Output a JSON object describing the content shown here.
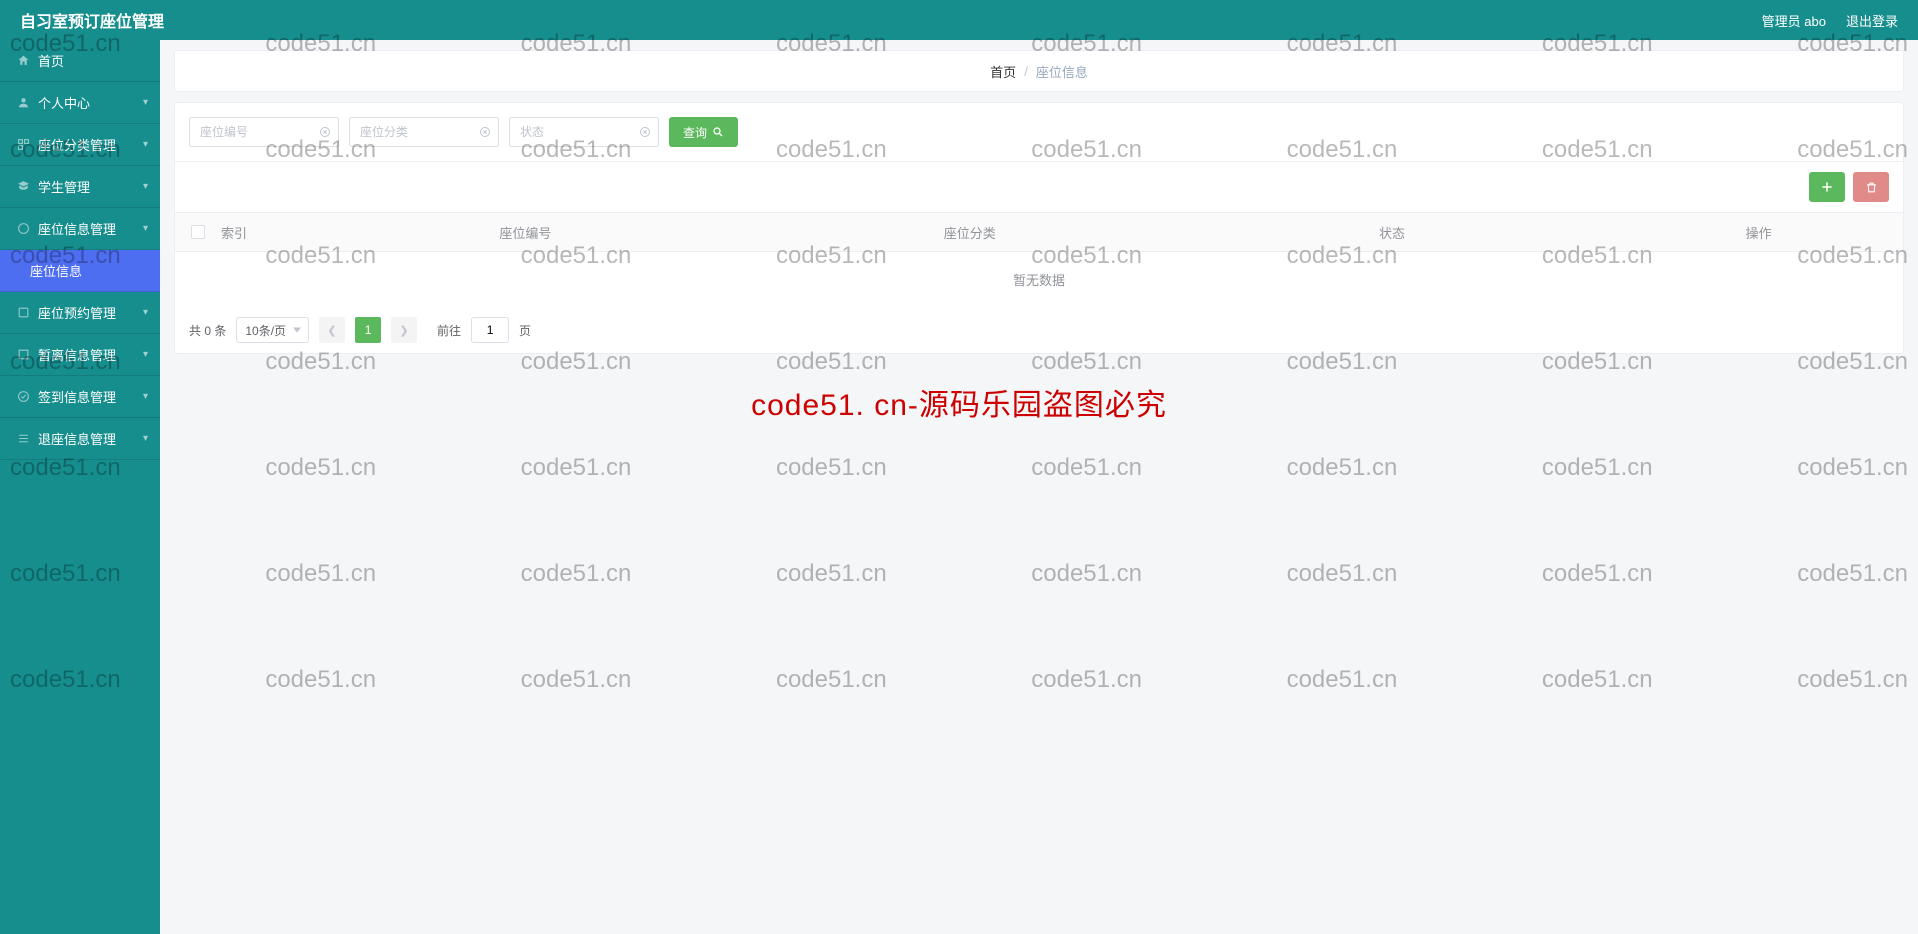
{
  "header": {
    "title": "自习室预订座位管理",
    "user_label": "管理员 abo",
    "logout_label": "退出登录"
  },
  "sidebar": {
    "items": [
      {
        "label": "首页",
        "icon": "home-icon"
      },
      {
        "label": "个人中心",
        "icon": "user-icon"
      },
      {
        "label": "座位分类管理",
        "icon": "category-icon"
      },
      {
        "label": "学生管理",
        "icon": "student-icon"
      },
      {
        "label": "座位信息管理",
        "icon": "seat-icon"
      },
      {
        "label": "座位信息",
        "icon": ""
      },
      {
        "label": "座位预约管理",
        "icon": "booking-icon"
      },
      {
        "label": "暂离信息管理",
        "icon": "leave-icon"
      },
      {
        "label": "签到信息管理",
        "icon": "checkin-icon"
      },
      {
        "label": "退座信息管理",
        "icon": "exit-icon"
      }
    ]
  },
  "breadcrumb": {
    "home": "首页",
    "sep": "/",
    "current": "座位信息"
  },
  "search": {
    "seat_code_ph": "座位编号",
    "seat_cat_ph": "座位分类",
    "status_ph": "状态",
    "query_label": "查询"
  },
  "toolbar": {
    "add_icon": "plus-icon",
    "del_icon": "trash-icon"
  },
  "table": {
    "columns": {
      "index": "索引",
      "seat_code": "座位编号",
      "seat_cat": "座位分类",
      "status": "状态",
      "operate": "操作"
    },
    "empty_text": "暂无数据",
    "rows": []
  },
  "pagination": {
    "total_text": "共 0 条",
    "page_size": "10条/页",
    "current_page": "1",
    "goto_prefix": "前往",
    "goto_value": "1",
    "goto_suffix": "页"
  },
  "watermark": {
    "text": "code51.cn",
    "banner": "code51. cn-源码乐园盗图必究"
  }
}
